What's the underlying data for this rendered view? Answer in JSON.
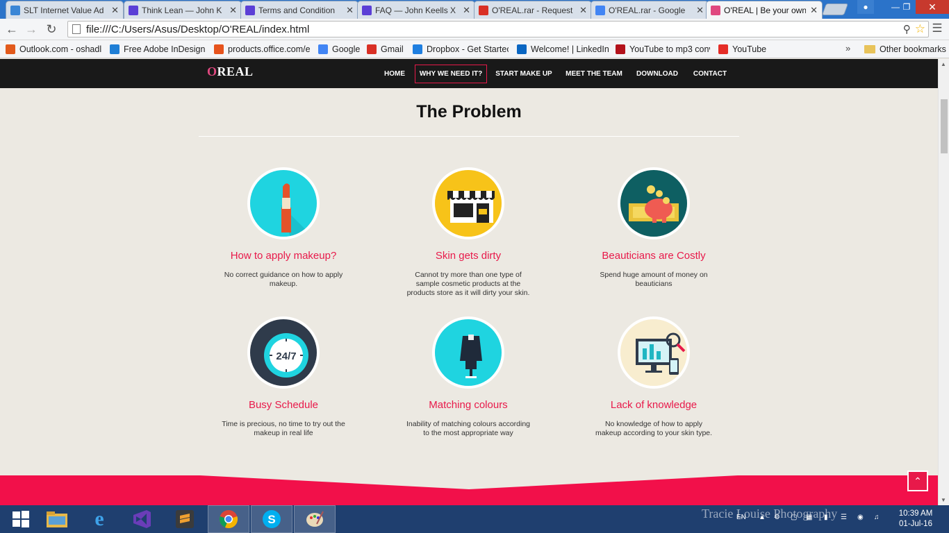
{
  "browser": {
    "tabs": [
      {
        "title": "SLT Internet Value Ad",
        "icon": "slt-icon",
        "color": "#3a86d6"
      },
      {
        "title": "Think Lean — John K",
        "icon": "x-icon",
        "color": "#5b3fd6"
      },
      {
        "title": "Terms and Condition",
        "icon": "x-icon",
        "color": "#5b3fd6"
      },
      {
        "title": "FAQ — John Keells X",
        "icon": "x-icon",
        "color": "#5b3fd6"
      },
      {
        "title": "O'REAL.rar - Request",
        "icon": "gmail-icon",
        "color": "#d93025"
      },
      {
        "title": "O'REAL.rar - Google",
        "icon": "gdoc-icon",
        "color": "#4285f4"
      },
      {
        "title": "O'REAL | Be your own",
        "icon": "oreal-icon",
        "color": "#e0487f"
      }
    ],
    "address": "file:///C:/Users/Asus/Desktop/O'REAL/index.html",
    "bookmarks": [
      {
        "label": "Outlook.com - oshadl",
        "icon": "windows-icon",
        "color": "#e25a1c"
      },
      {
        "label": "Free Adobe InDesign",
        "icon": "sync-icon",
        "color": "#1f7fd6"
      },
      {
        "label": "products.office.com/e",
        "icon": "office-icon",
        "color": "#e6531c"
      },
      {
        "label": "Google",
        "icon": "google-icon",
        "color": "#4285f4"
      },
      {
        "label": "Gmail",
        "icon": "gmail-icon",
        "color": "#d93025"
      },
      {
        "label": "Dropbox - Get Startec",
        "icon": "dropbox-icon",
        "color": "#1f7fe0"
      },
      {
        "label": "Welcome! | LinkedIn",
        "icon": "linkedin-icon",
        "color": "#0a66c2"
      },
      {
        "label": "YouTube to mp3 conv",
        "icon": "mp3-icon",
        "color": "#b3121b"
      },
      {
        "label": "YouTube",
        "icon": "youtube-icon",
        "color": "#e52d27"
      }
    ],
    "bookmarks_more": "»",
    "other_bookmarks": "Other bookmarks"
  },
  "site": {
    "logo": {
      "o": "O",
      "rest": "REAL"
    },
    "nav": [
      "HOME",
      "WHY WE NEED IT?",
      "START MAKE UP",
      "MEET THE TEAM",
      "DOWNLOAD",
      "CONTACT"
    ],
    "active_nav": "WHY WE NEED IT?",
    "section_title": "The Problem",
    "accent": "#e8194a",
    "features": [
      {
        "title": "How to apply makeup?",
        "text": "No correct guidance on how to apply makeup.",
        "icon": "lipstick-icon"
      },
      {
        "title": "Skin gets dirty",
        "text": "Cannot try more than one type of sample cosmetic products at the products store as it will dirty your skin.",
        "icon": "store-icon"
      },
      {
        "title": "Beauticians are Costly",
        "text": "Spend huge amount of money on beauticians",
        "icon": "piggy-bank-icon"
      },
      {
        "title": "Busy Schedule",
        "text": "Time is precious, no time to try out the makeup in real life",
        "icon": "clock-24-7-icon"
      },
      {
        "title": "Matching colours",
        "text": "Inability of matching colours according to the most appropriate way",
        "icon": "dress-icon"
      },
      {
        "title": "Lack of knowledge",
        "text": "No knowledge of how to apply makeup according to your skin type.",
        "icon": "computer-search-icon"
      }
    ],
    "clock_text": "24/7",
    "totop": "⌃"
  },
  "taskbar": {
    "watermark": "Tracie Louise Photography",
    "lang": "EN",
    "time": "10:39 AM",
    "date": "01-Jul-16"
  }
}
